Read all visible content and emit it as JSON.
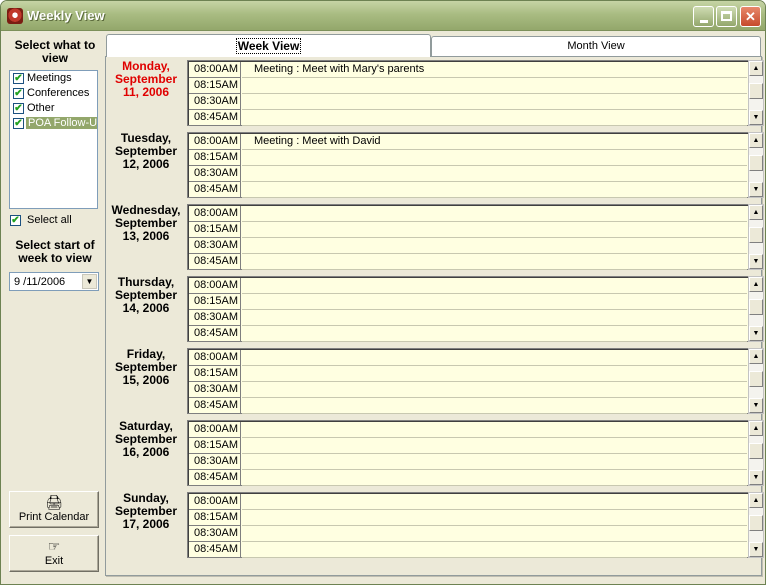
{
  "window": {
    "title": "Weekly View"
  },
  "sidebar": {
    "select_what_label": "Select what to view",
    "categories": [
      {
        "label": "Meetings",
        "checked": true
      },
      {
        "label": "Conferences",
        "checked": true
      },
      {
        "label": "Other",
        "checked": true
      },
      {
        "label": "POA Follow-Up",
        "checked": true,
        "selected": true
      }
    ],
    "select_all_label": "Select all",
    "select_all_checked": true,
    "select_start_label": "Select start of week to view",
    "start_date_value": "9 /11/2006",
    "print_label": "Print Calendar",
    "exit_label": "Exit"
  },
  "tabs": {
    "week": "Week View",
    "month": "Month View",
    "active": "week"
  },
  "week": {
    "times": [
      "08:00AM",
      "08:15AM",
      "08:30AM",
      "08:45AM"
    ],
    "days": [
      {
        "label": "Monday, September 11, 2006",
        "today": true,
        "events": [
          "Meeting : Meet with Mary's parents",
          "",
          "",
          ""
        ]
      },
      {
        "label": "Tuesday, September 12, 2006",
        "today": false,
        "events": [
          "Meeting : Meet with David",
          "",
          "",
          ""
        ]
      },
      {
        "label": "Wednesday, September 13, 2006",
        "today": false,
        "events": [
          "",
          "",
          "",
          ""
        ]
      },
      {
        "label": "Thursday, September 14, 2006",
        "today": false,
        "events": [
          "",
          "",
          "",
          ""
        ]
      },
      {
        "label": "Friday, September 15, 2006",
        "today": false,
        "events": [
          "",
          "",
          "",
          ""
        ]
      },
      {
        "label": "Saturday, September 16, 2006",
        "today": false,
        "events": [
          "",
          "",
          "",
          ""
        ]
      },
      {
        "label": "Sunday, September 17, 2006",
        "today": false,
        "events": [
          "",
          "",
          "",
          ""
        ]
      }
    ]
  },
  "colors": {
    "today_label": "#E00000",
    "grid_background": "#FFFFE1",
    "selected_item": "#93A76B"
  },
  "icons": {
    "print": "printer-icon",
    "exit": "pointing-hand-icon"
  }
}
